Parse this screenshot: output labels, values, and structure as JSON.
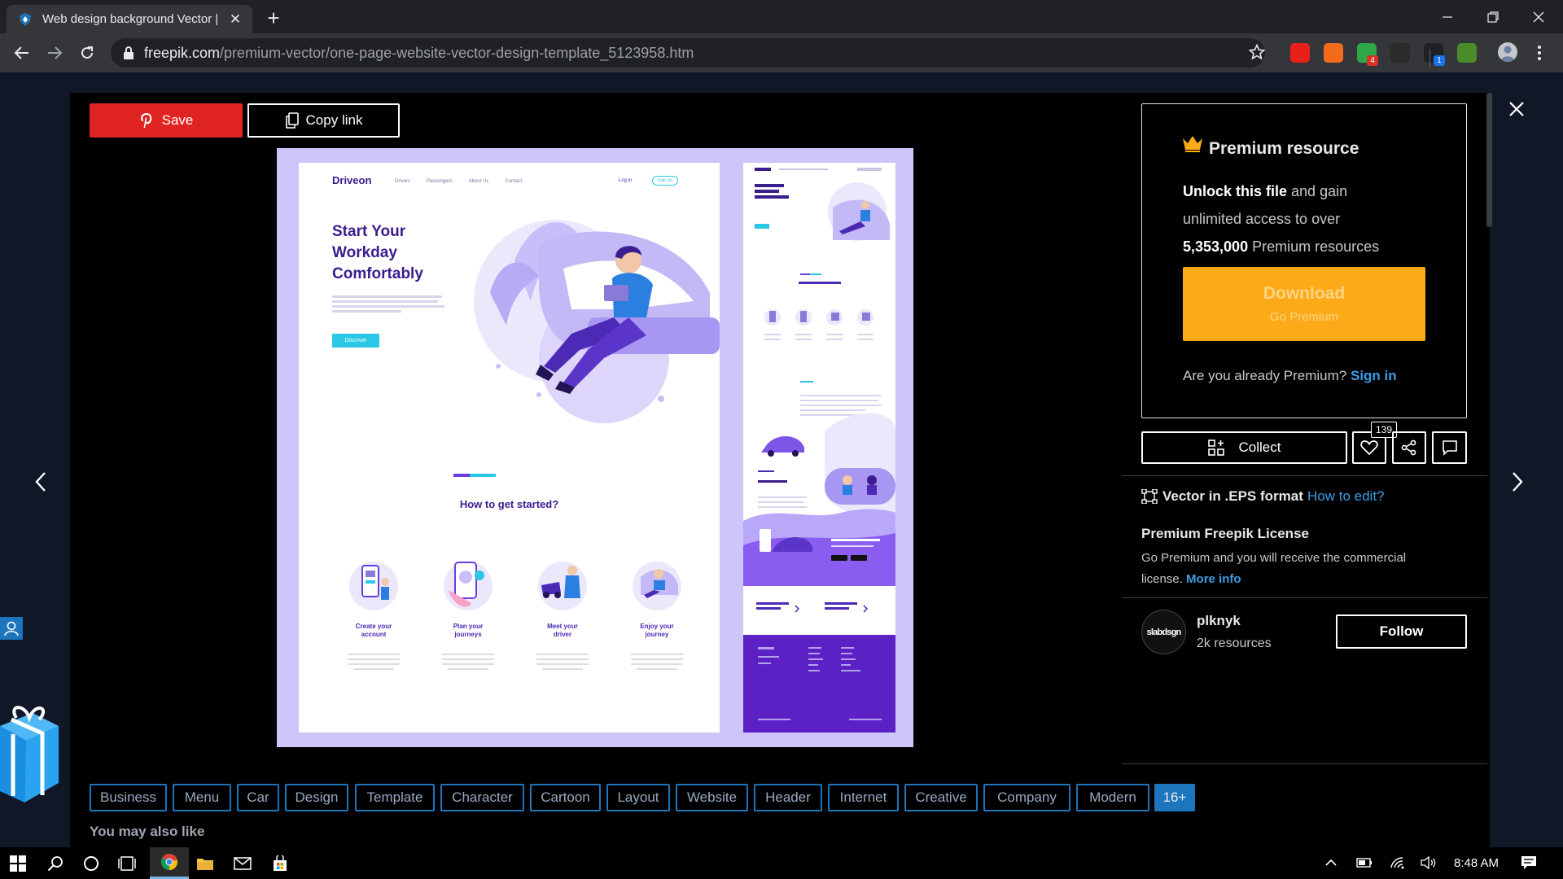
{
  "browser": {
    "tab_title": "Web design background Vector |",
    "tab_close": "✕",
    "new_tab": "+",
    "url_domain": "freepik.com",
    "url_path": "/premium-vector/one-page-website-vector-design-template_5123958.htm",
    "extensions": [
      {
        "icon": "red-hand-extension-icon",
        "color": "#e8201a"
      },
      {
        "icon": "orange-bag-extension-icon",
        "color": "#f26b1d"
      },
      {
        "icon": "green-check-extension-icon",
        "color": "#2ea84a",
        "badge": "4"
      },
      {
        "icon": "dark-face-extension-icon",
        "color": "#2b2b2b"
      },
      {
        "icon": "box-extension-icon",
        "color": "#202124",
        "badge": "1"
      },
      {
        "icon": "colorful-extension-icon",
        "color": "#4b8c2a"
      }
    ]
  },
  "actions": {
    "save_label": "Save",
    "copy_label": "Copy link"
  },
  "preview": {
    "brand": "Driveon",
    "nav": [
      "Drivers",
      "Passengers",
      "About Us",
      "Contact"
    ],
    "login": "Log in",
    "signup": "Sign Up",
    "hero_title": [
      "Start Your",
      "Workday",
      "Comfortably"
    ],
    "hero_cta": "Discover",
    "how_title": "How to get started?",
    "steps": [
      {
        "title": [
          "Create your",
          "account"
        ]
      },
      {
        "title": [
          "Plan your",
          "journeys"
        ]
      },
      {
        "title": [
          "Meet your",
          "driver"
        ]
      },
      {
        "title": [
          "Enjoy your",
          "journey"
        ]
      }
    ]
  },
  "premium": {
    "title": "Premium resource",
    "unlock_bold": "Unlock this file",
    "unlock_rest": " and gain",
    "line2": "unlimited access to over",
    "count": "5,353,000",
    "count_rest": " Premium resources",
    "download_label": "Download",
    "download_sub": "Go Premium",
    "already_text": "Are you already Premium? ",
    "sign_in": "Sign in"
  },
  "social": {
    "collect_label": "Collect",
    "likes_count": "139"
  },
  "format": {
    "label": "Vector in .EPS format",
    "how_to_edit": "How to edit?"
  },
  "license": {
    "title": "Premium Freepik License",
    "text_line1": "Go Premium and you will receive the commercial",
    "text_line2": "license. ",
    "more_info": "More info"
  },
  "author": {
    "avatar_text": "slabdsgn",
    "name": "plknyk",
    "resources": "2k resources",
    "follow_label": "Follow"
  },
  "tags": [
    "Business",
    "Menu",
    "Car",
    "Design",
    "Template",
    "Character",
    "Cartoon",
    "Layout",
    "Website",
    "Header",
    "Internet",
    "Creative",
    "Company",
    "Modern"
  ],
  "tags_more": "16+",
  "you_may_like": "You may also like",
  "taskbar": {
    "time": "8:48 AM"
  },
  "colors": {
    "accent_blue": "#1d75bb",
    "download_orange": "#fcaa18",
    "save_red": "#e02424",
    "link_blue": "#3d9ce6"
  }
}
